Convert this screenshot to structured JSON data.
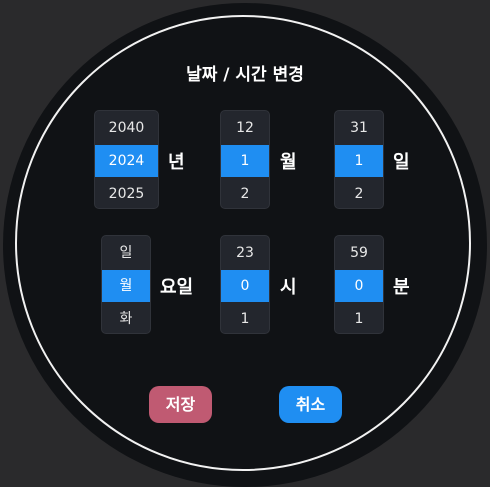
{
  "dialog": {
    "title": "날짜 / 시간 변경"
  },
  "pickers": {
    "year": {
      "prev": "2040",
      "selected": "2024",
      "next": "2025",
      "unit": "년"
    },
    "month": {
      "prev": "12",
      "selected": "1",
      "next": "2",
      "unit": "월"
    },
    "day": {
      "prev": "31",
      "selected": "1",
      "next": "2",
      "unit": "일"
    },
    "weekday": {
      "prev": "일",
      "selected": "월",
      "next": "화",
      "unit": "요일"
    },
    "hour": {
      "prev": "23",
      "selected": "0",
      "next": "1",
      "unit": "시"
    },
    "minute": {
      "prev": "59",
      "selected": "0",
      "next": "1",
      "unit": "분"
    }
  },
  "buttons": {
    "save_label": "저장",
    "cancel_label": "취소"
  },
  "colors": {
    "background": "#2a2a2c",
    "face": "#101215",
    "accent": "#1f8ef2",
    "save": "#c05a72",
    "cancel": "#1f8ef2"
  }
}
